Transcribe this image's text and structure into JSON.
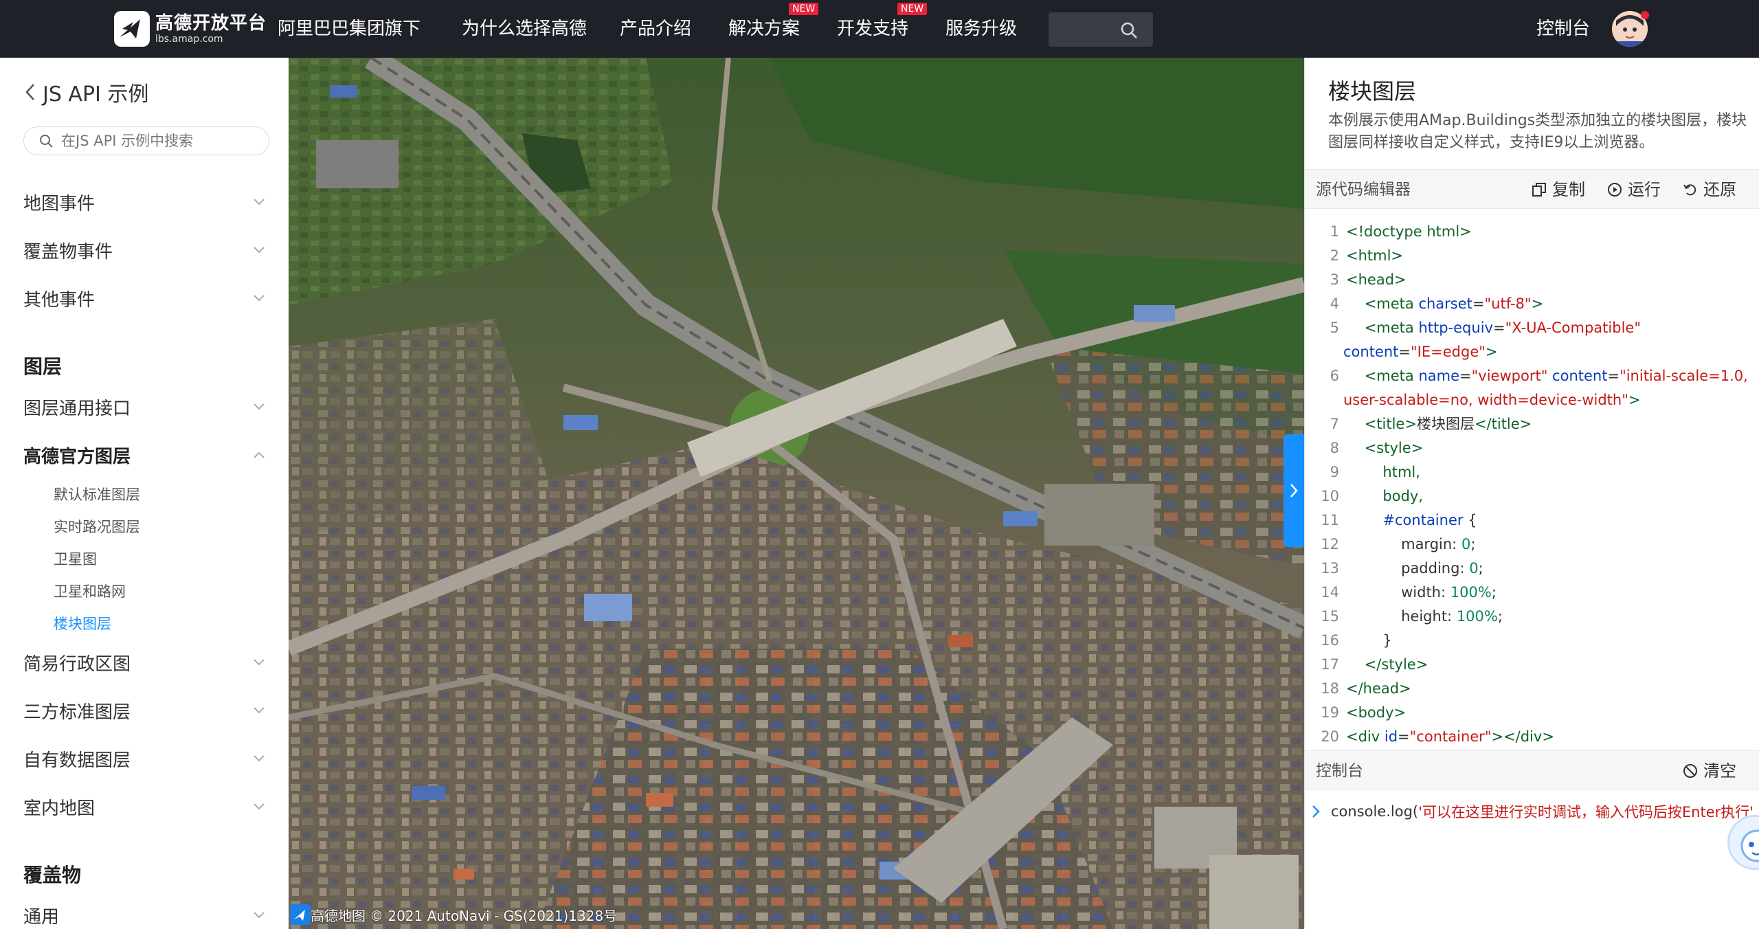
{
  "header": {
    "logo_title": "高德开放平台",
    "logo_sub": "lbs.amap.com",
    "nav": [
      {
        "label": "阿里巴巴集团旗下",
        "badge": ""
      },
      {
        "label": "为什么选择高德",
        "badge": ""
      },
      {
        "label": "产品介绍",
        "badge": ""
      },
      {
        "label": "解决方案",
        "badge": "NEW"
      },
      {
        "label": "开发支持",
        "badge": "NEW"
      },
      {
        "label": "服务升级",
        "badge": ""
      }
    ],
    "console_label": "控制台",
    "icons": {
      "search": "search-icon",
      "avatar": "user-avatar"
    }
  },
  "sidebar": {
    "back_label": "JS API 示例",
    "search_placeholder": "在JS API 示例中搜索",
    "groups_top": [
      "地图事件",
      "覆盖物事件",
      "其他事件"
    ],
    "section_layers": "图层",
    "layer_items": [
      "图层通用接口",
      "高德官方图层"
    ],
    "official_sub": [
      "默认标准图层",
      "实时路况图层",
      "卫星图",
      "卫星和路网",
      "楼块图层"
    ],
    "more_items": [
      "简易行政区图",
      "三方标准图层",
      "自有数据图层",
      "室内地图"
    ],
    "section_overlays": "覆盖物",
    "overlay_items": [
      "通用"
    ]
  },
  "map": {
    "attribution_logo": "高德地图",
    "attribution_text": "© 2021 AutoNavi - GS(2021)1328号"
  },
  "panel": {
    "title": "楼块图层",
    "description": "本例展示使用AMap.Buildings类型添加独立的楼块图层，楼块图层同样接收自定义样式，支持IE9以上浏览器。",
    "editor_label": "源代码编辑器",
    "copy_label": "复制",
    "run_label": "运行",
    "restore_label": "还原",
    "console_label": "控制台",
    "clear_label": "清空",
    "console_output_prefix": "console.log(",
    "console_output_string": "'可以在这里进行实时调试，输入代码后按Enter执行'"
  },
  "code_lines": [
    {
      "n": "1"
    },
    {
      "n": "2"
    },
    {
      "n": "3"
    },
    {
      "n": "4"
    },
    {
      "n": "5"
    },
    {
      "n": ""
    },
    {
      "n": "6"
    },
    {
      "n": ""
    },
    {
      "n": "7"
    },
    {
      "n": "8"
    },
    {
      "n": "9"
    },
    {
      "n": "10"
    },
    {
      "n": "11"
    },
    {
      "n": "12"
    },
    {
      "n": "13"
    },
    {
      "n": "14"
    },
    {
      "n": "15"
    },
    {
      "n": "16"
    },
    {
      "n": "17"
    },
    {
      "n": "18"
    },
    {
      "n": "19"
    },
    {
      "n": "20"
    }
  ],
  "code_text": {
    "l1": "<!doctype html>",
    "l2": "<html>",
    "l3": "<head>",
    "l4_tag": "<meta ",
    "l4_attr": "charset",
    "l4_val": "\"utf-8\"",
    "l4_end": ">",
    "l5_tag": "<meta ",
    "l5_attr": "http-equiv",
    "l5_val": "\"X-UA-Compatible\"",
    "l5b_attr": "content",
    "l5b_val": "\"IE=edge\"",
    "l5b_end": ">",
    "l6_tag": "<meta ",
    "l6_attr1": "name",
    "l6_val1": "\"viewport\"",
    "l6_attr2": "content",
    "l6_val2": "\"initial-scale=1.0,",
    "l6b_val": "user-scalable=no, width=device-width\"",
    "l6b_end": ">",
    "l7_open": "<title>",
    "l7_text": "楼块图层",
    "l7_close": "</title>",
    "l8": "<style>",
    "l9": "html,",
    "l10": "body,",
    "l11_sel": "#container",
    "l11_brace": " {",
    "l12_prop": "margin: ",
    "l12_val": "0",
    "l12_end": ";",
    "l13_prop": "padding: ",
    "l13_val": "0",
    "l13_end": ";",
    "l14_prop": "width: ",
    "l14_val": "100%",
    "l14_end": ";",
    "l15_prop": "height: ",
    "l15_val": "100%",
    "l15_end": ";",
    "l16": "}",
    "l17": "</style>",
    "l18": "</head>",
    "l19": "<body>",
    "l20_tag": "<div ",
    "l20_attr": "id",
    "l20_val": "\"container\"",
    "l20_end": "></div>"
  },
  "colors": {
    "accent": "#1890ff",
    "nav_bg": "#1f2128",
    "badge": "#e8233a"
  }
}
